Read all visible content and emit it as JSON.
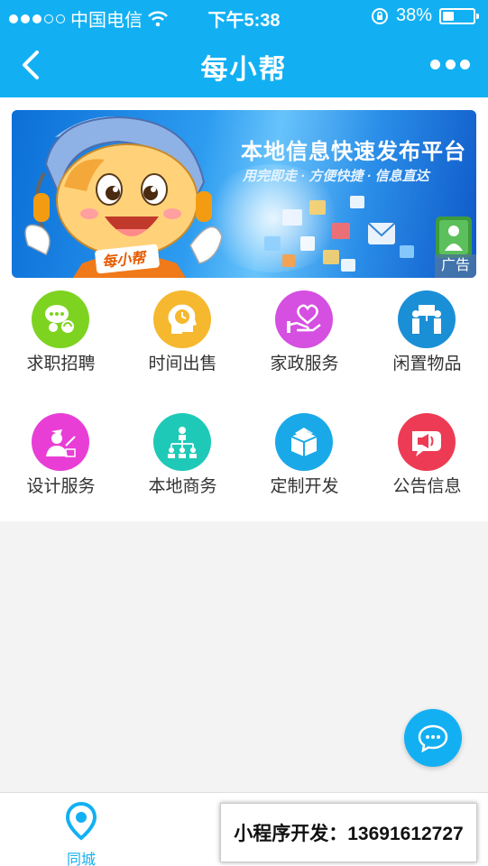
{
  "status_bar": {
    "carrier": "中国电信",
    "time": "下午5:38",
    "battery": "38%",
    "battery_level": 0.38
  },
  "nav": {
    "title": "每小帮"
  },
  "banner": {
    "title": "本地信息快速发布平台",
    "subtitle": "用完即走 · 方便快捷 · 信息直达",
    "ad_label": "广告",
    "mascot_text": "每小帮"
  },
  "categories": [
    {
      "label": "求职招聘",
      "icon": "job-chat-icon",
      "color": "#7ed321"
    },
    {
      "label": "时间出售",
      "icon": "clock-head-icon",
      "color": "#f5b82e"
    },
    {
      "label": "家政服务",
      "icon": "heart-hand-icon",
      "color": "#d54fe0"
    },
    {
      "label": "闲置物品",
      "icon": "people-board-icon",
      "color": "#1a8fd6"
    },
    {
      "label": "设计服务",
      "icon": "designer-icon",
      "color": "#e83ed6"
    },
    {
      "label": "本地商务",
      "icon": "org-chart-icon",
      "color": "#1ec9b7"
    },
    {
      "label": "定制开发",
      "icon": "box-icon",
      "color": "#1aa9e8"
    },
    {
      "label": "公告信息",
      "icon": "megaphone-icon",
      "color": "#ee3b55"
    }
  ],
  "tabs": [
    {
      "label": "同城",
      "icon": "location-pin-icon"
    }
  ],
  "watermark": {
    "text": "小程序开发：13691612727"
  },
  "colors": {
    "primary": "#12b0f3"
  }
}
